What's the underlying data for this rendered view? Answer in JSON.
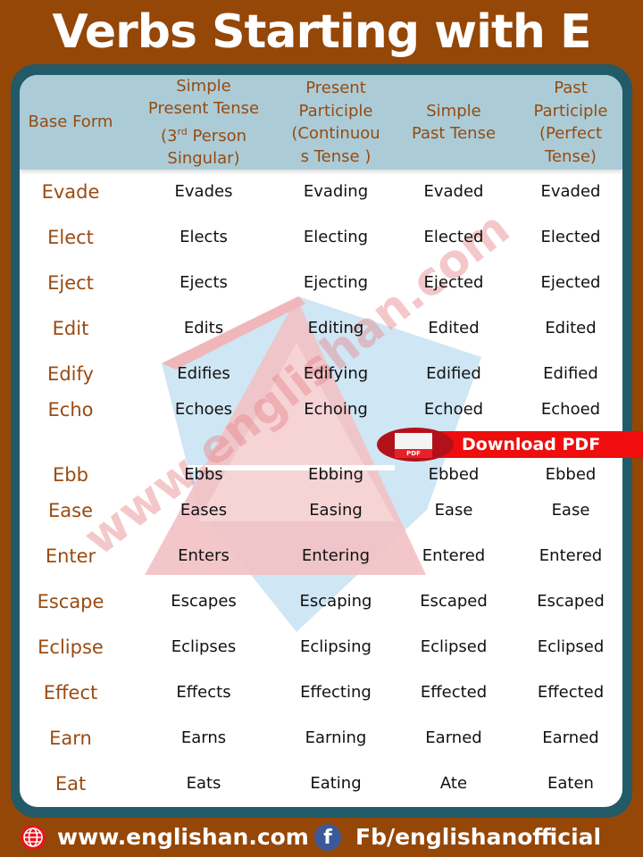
{
  "title": "Verbs Starting with E",
  "table": {
    "headers": [
      {
        "text": "Base Form"
      },
      {
        "text": "Simple\nPresent Tense\n(3",
        "sup": "rd",
        "rest": " Person\nSingular)"
      },
      {
        "text": "Present\nParticiple\n(Continuou\ns Tense )"
      },
      {
        "text": "Simple\nPast Tense"
      },
      {
        "text": "Past\nParticiple\n(Perfect\nTense)"
      }
    ],
    "rows": [
      [
        "Evade",
        "Evades",
        "Evading",
        "Evaded",
        "Evaded"
      ],
      [
        "Elect",
        "Elects",
        "Electing",
        "Elected",
        "Elected"
      ],
      [
        "Eject",
        "Ejects",
        "Ejecting",
        "Ejected",
        "Ejected"
      ],
      [
        "Edit",
        "Edits",
        "Editing",
        "Edited",
        "Edited"
      ],
      [
        "Edify",
        "Edifies",
        "Edifying",
        "Edified",
        "Edified"
      ],
      [
        "Echo",
        "Echoes",
        "Echoing",
        "Echoed",
        "Echoed"
      ],
      [
        "Ebb",
        "Ebbs",
        "Ebbing",
        "Ebbed",
        "Ebbed"
      ],
      [
        "Ease",
        "Eases",
        "Easing",
        "Ease",
        "Ease"
      ],
      [
        "Enter",
        "Enters",
        "Entering",
        "Entered",
        "Entered"
      ],
      [
        "Escape",
        "Escapes",
        "Escaping",
        "Escaped",
        "Escaped"
      ],
      [
        "Eclipse",
        "Eclipses",
        "Eclipsing",
        "Eclipsed",
        "Eclipsed"
      ],
      [
        "Effect",
        "Effects",
        "Effecting",
        "Effected",
        "Effected"
      ],
      [
        "Earn",
        "Earns",
        "Earning",
        "Earned",
        "Earned"
      ],
      [
        "Eat",
        "Eats",
        "Eating",
        "Ate",
        "Eaten"
      ]
    ]
  },
  "watermark": {
    "text": "www.englishan.com",
    "icon": "englishan-logo-icon"
  },
  "download": {
    "label": "Download PDF",
    "icon_label": "PDF",
    "icon": "pdf-file-icon"
  },
  "footer": {
    "website": "www.englishan.com",
    "website_icon": "globe-icon",
    "facebook": "Fb/englishanofficial",
    "facebook_icon": "facebook-icon",
    "facebook_glyph": "f"
  },
  "colors": {
    "background": "#954708",
    "frame": "#225a68",
    "header_bg": "#abccd7",
    "base_text": "#9a4b12",
    "download_red": "#f00d0d"
  }
}
